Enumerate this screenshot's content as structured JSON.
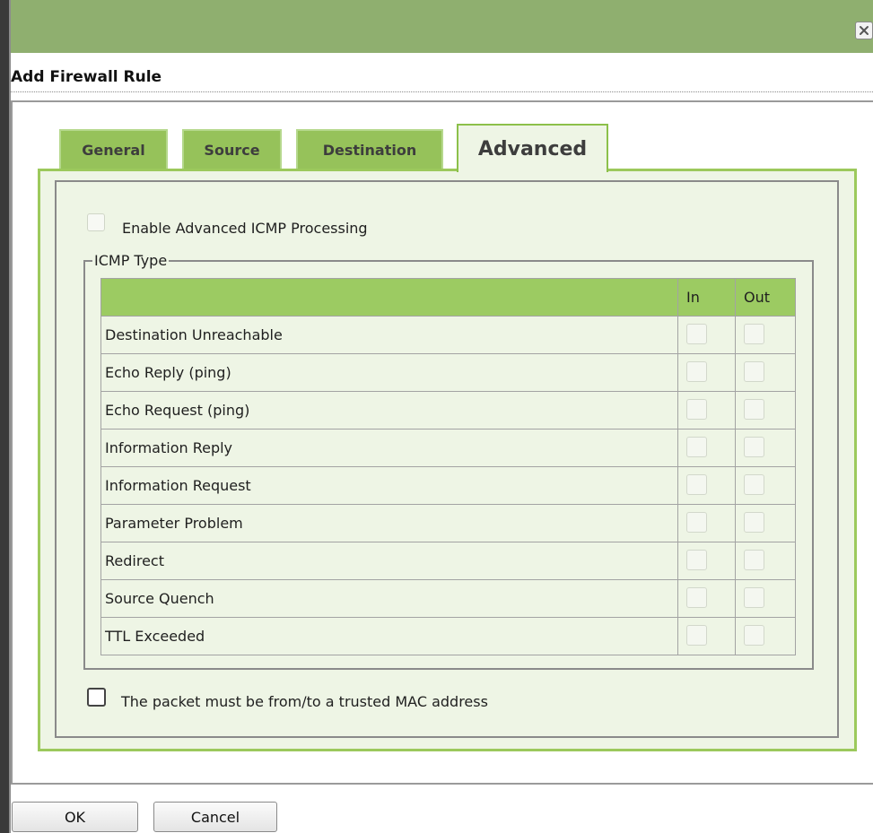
{
  "dialog": {
    "title": "Add Firewall Rule",
    "close_icon": "close-icon"
  },
  "tabs": [
    {
      "label": "General",
      "active": false
    },
    {
      "label": "Source",
      "active": false
    },
    {
      "label": "Destination",
      "active": false
    },
    {
      "label": "Advanced",
      "active": true
    }
  ],
  "advanced": {
    "enable_icmp_label": "Enable Advanced ICMP Processing",
    "enable_icmp_checked": false,
    "enable_icmp_disabled": true,
    "icmp_group_label": "ICMP Type",
    "table": {
      "columns": [
        "",
        "In",
        "Out"
      ],
      "rows": [
        {
          "type": "Destination Unreachable",
          "in": false,
          "out": false
        },
        {
          "type": "Echo Reply (ping)",
          "in": false,
          "out": false
        },
        {
          "type": "Echo Request (ping)",
          "in": false,
          "out": false
        },
        {
          "type": "Information Reply",
          "in": false,
          "out": false
        },
        {
          "type": "Information Request",
          "in": false,
          "out": false
        },
        {
          "type": "Parameter Problem",
          "in": false,
          "out": false
        },
        {
          "type": "Redirect",
          "in": false,
          "out": false
        },
        {
          "type": "Source Quench",
          "in": false,
          "out": false
        },
        {
          "type": "TTL Exceeded",
          "in": false,
          "out": false
        }
      ]
    },
    "trusted_mac_label": "The packet must be from/to a trusted MAC address",
    "trusted_mac_checked": false
  },
  "buttons": {
    "ok_label": "OK",
    "cancel_label": "Cancel"
  },
  "colors": {
    "titlebar": "#8faf6f",
    "tab": "#96c25a",
    "panel": "#eef5e5",
    "table_header": "#9ccb62"
  }
}
